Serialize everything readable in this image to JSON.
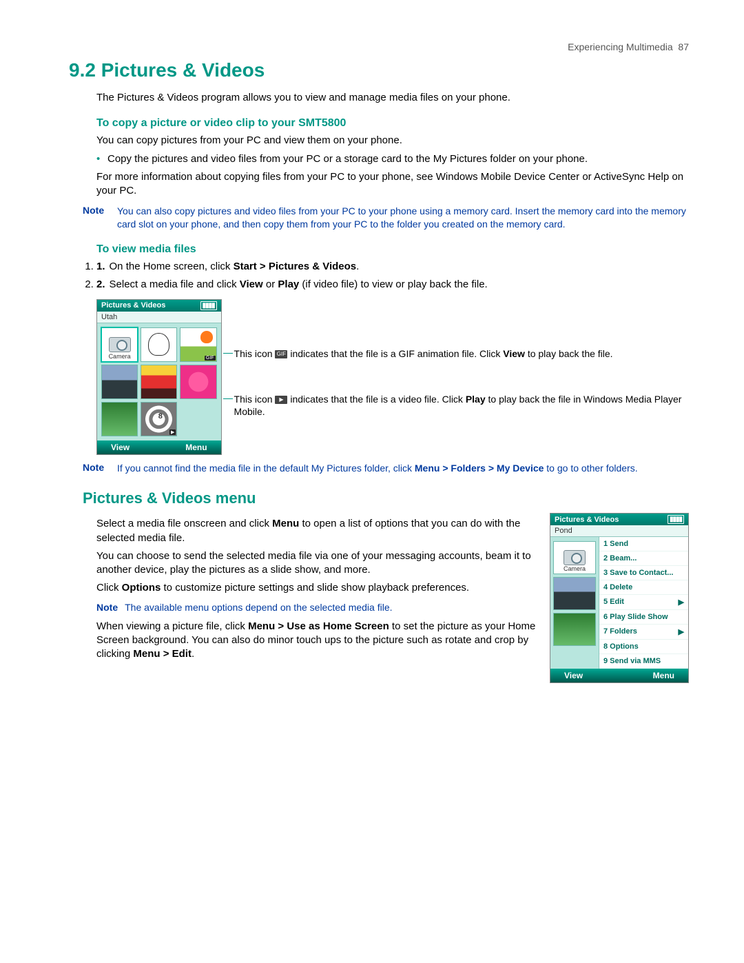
{
  "header": {
    "running": "Experiencing Multimedia",
    "page": "87"
  },
  "h1": {
    "num": "9.2",
    "title": "Pictures & Videos"
  },
  "intro": "The Pictures & Videos program allows you to view and manage media files on your phone.",
  "copy": {
    "title": "To copy a picture or video clip to your SMT5800",
    "p1": "You can copy pictures from your PC and view them on your phone.",
    "b1": "Copy the pictures and video files from your PC or a storage card to the My Pictures folder on your phone.",
    "p2": "For more information about copying files from your PC to your phone, see Windows Mobile Device Center or ActiveSync Help on your PC."
  },
  "note1": {
    "label": "Note",
    "text": "You can also copy pictures and video files from your PC to your phone using a memory card. Insert the memory card into the memory card slot on your phone, and then copy them from your PC to the folder you created on the memory card."
  },
  "view": {
    "title": "To view media files",
    "s1_a": "On the Home screen, click ",
    "s1_b": "Start > Pictures & Videos",
    "s1_c": ".",
    "s2_a": "Select a media file and click ",
    "s2_b": "View",
    "s2_c": " or ",
    "s2_d": "Play",
    "s2_e": " (if video file) to view or play back the file."
  },
  "fig1": {
    "title": "Pictures & Videos",
    "folder": "Utah",
    "camera": "Camera",
    "view": "View",
    "menu": "Menu",
    "gif_badge": "GIF",
    "vid_badge": "▶",
    "co1_a": "This icon ",
    "co1_b": " indicates that the file is a GIF animation file. Click ",
    "co1_c": "View",
    "co1_d": " to play back the file.",
    "co2_a": "This icon ",
    "co2_b": " indicates that the file is a video file. Click ",
    "co2_c": "Play",
    "co2_d": " to play back the file in Windows Media Player Mobile."
  },
  "note2": {
    "label": "Note",
    "a": "If you cannot find the media file in the default My Pictures folder, click ",
    "b": "Menu > Folders > My Device",
    "c": " to go to other folders."
  },
  "menu": {
    "title": "Pictures & Videos menu",
    "p1_a": "Select a media file onscreen and click ",
    "p1_b": "Menu",
    "p1_c": " to open a list of options that you can do with the selected media file.",
    "p2": "You can choose to send the selected media file via one of your messaging accounts, beam it to another device, play the pictures as a slide show, and more.",
    "p3_a": "Click ",
    "p3_b": "Options",
    "p3_c": " to customize picture settings and slide show playback preferences.",
    "note_label": "Note",
    "note_text": "The available menu options depend on the selected media file.",
    "p4_a": "When viewing a picture file, click ",
    "p4_b": "Menu > Use as Home Screen",
    "p4_c": " to set the picture as your Home Screen background. You can also do minor touch ups to the picture such as rotate and crop by clicking ",
    "p4_d": "Menu > Edit",
    "p4_e": "."
  },
  "fig2": {
    "title": "Pictures & Videos",
    "folder": "Pond",
    "camera": "Camera",
    "view": "View",
    "menu": "Menu",
    "items": [
      "1 Send",
      "2 Beam...",
      "3 Save to Contact...",
      "4 Delete",
      "5 Edit",
      "6 Play Slide Show",
      "7 Folders",
      "8 Options",
      "9 Send via MMS"
    ]
  }
}
